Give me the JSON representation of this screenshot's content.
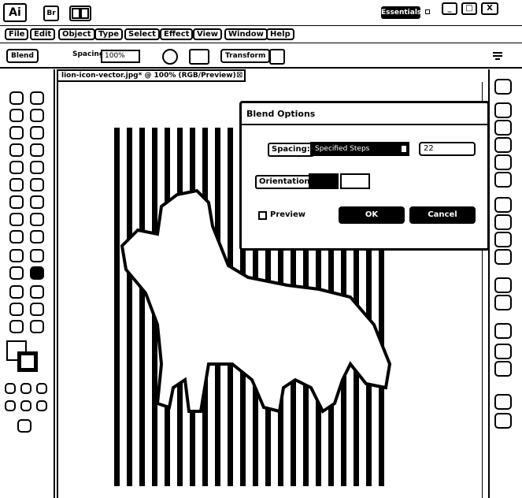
{
  "titlebar": {
    "app_logo": "Ai",
    "bridge_label": "Br",
    "workspace_label": "Essentials",
    "min_label": "_",
    "restore_label": "□",
    "close_label": "X"
  },
  "menubar": {
    "items": [
      "File",
      "Edit",
      "Object",
      "Type",
      "Select",
      "Effect",
      "View",
      "Window",
      "Help"
    ]
  },
  "controlbar": {
    "object_label": "Blend",
    "spacing_label": "Spacing:",
    "spacing_value": "100%",
    "transform_label": "Transform"
  },
  "document": {
    "tab_title": "lion-icon-vector.jpg* @ 100% (RGB/Preview)",
    "tab_close": "⊠"
  },
  "dialog": {
    "title": "Blend Options",
    "spacing_label": "Spacing:",
    "spacing_option": "Specified Steps",
    "steps_value": "22",
    "orientation_label": "Orientation:",
    "preview_label": "Preview",
    "ok_label": "OK",
    "cancel_label": "Cancel"
  },
  "colors": {
    "background": "#ffffff",
    "foreground": "#000000"
  }
}
